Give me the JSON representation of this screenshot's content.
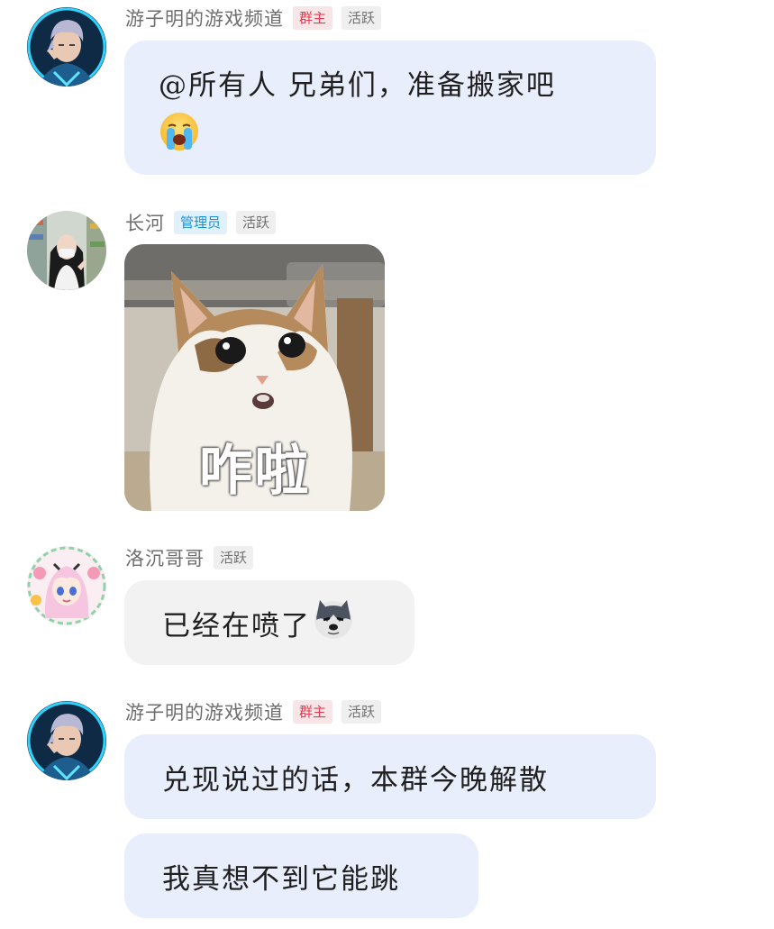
{
  "messages": [
    {
      "sender": "游子明的游戏频道",
      "badges": [
        "群主",
        "活跃"
      ],
      "text": "@所有人 兄弟们，准备搬家吧",
      "emoji": "loudly-crying-face-emoji"
    },
    {
      "sender": "长河",
      "badges": [
        "管理员",
        "活跃"
      ],
      "sticker_caption": "咋啦"
    },
    {
      "sender": "洛沉哥哥",
      "badges": [
        "活跃"
      ],
      "text": "已经在喷了",
      "emoji": "husky-dog-emoji"
    },
    {
      "sender": "游子明的游戏频道",
      "badges": [
        "群主",
        "活跃"
      ],
      "text": "兑现说过的话，本群今晚解散"
    },
    {
      "text": "我真想不到它能跳"
    }
  ],
  "colors": {
    "owner_badge_bg": "#f7e5e7",
    "owner_badge_text": "#e03e52",
    "admin_badge_bg": "#e1f1fb",
    "admin_badge_text": "#1c91d2",
    "active_badge_bg": "#efefef",
    "self_bubble": "#e9eefc",
    "other_bubble": "#f2f2f2"
  }
}
